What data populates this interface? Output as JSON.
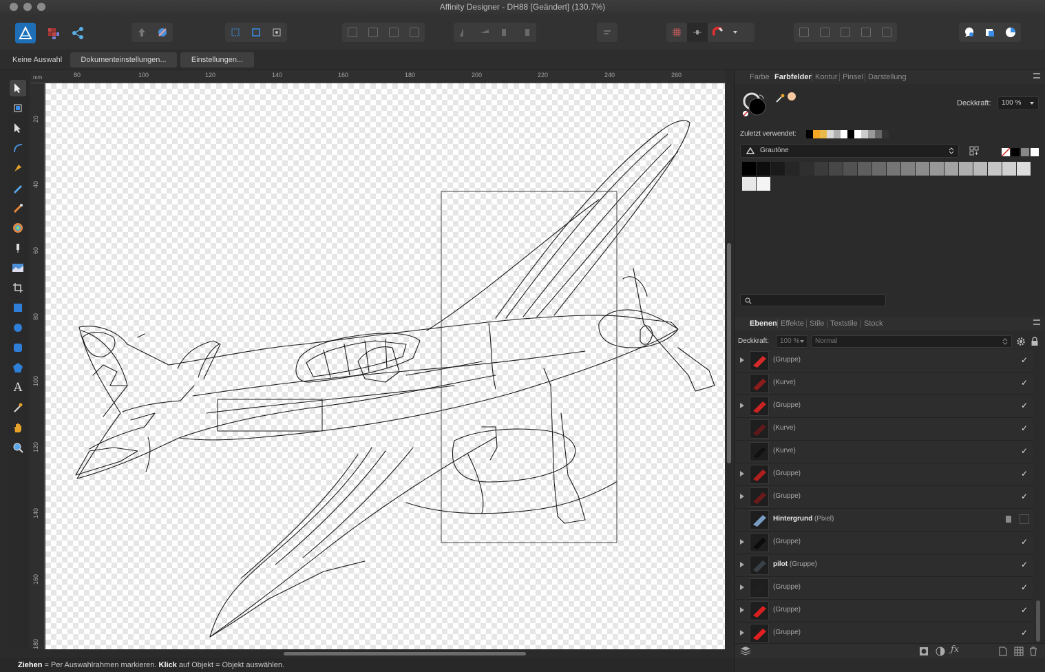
{
  "window": {
    "title": "Affinity Designer - DH88 [Geändert] (130.7%)"
  },
  "personas": [
    "designer-persona-icon",
    "pixel-persona-icon",
    "export-persona-icon"
  ],
  "context": {
    "selection": "Keine Auswahl",
    "doc_settings": "Dokumenteinstellungen...",
    "settings": "Einstellungen..."
  },
  "ruler": {
    "unit": "mm",
    "h_ticks": [
      "80",
      "100",
      "120",
      "140",
      "160",
      "180",
      "200",
      "220",
      "240",
      "260"
    ],
    "v_ticks": [
      "20",
      "40",
      "60",
      "80",
      "100",
      "120",
      "140",
      "160",
      "180"
    ]
  },
  "tools": [
    "move-tool-icon",
    "artboard-tool-icon",
    "node-tool-icon",
    "corner-tool-icon",
    "pen-tool-icon",
    "pencil-tool-icon",
    "brush-tool-icon",
    "fill-tool-icon",
    "transparency-tool-icon",
    "place-image-tool-icon",
    "crop-tool-icon",
    "rectangle-tool-icon",
    "ellipse-tool-icon",
    "rounded-rect-tool-icon",
    "polygon-tool-icon",
    "text-tool-icon",
    "color-picker-tool-icon",
    "hand-tool-icon",
    "zoom-tool-icon"
  ],
  "color_panel": {
    "tabs": [
      "Farbe",
      "Farbfelder",
      "Kontur",
      "Pinsel",
      "Darstellung"
    ],
    "active_tab": "Farbfelder",
    "opacity_label": "Deckkraft:",
    "opacity_value": "100 %",
    "recent_label": "Zuletzt verwendet:",
    "recent_colors": [
      "#000000",
      "#f5a623",
      "#e8b84a",
      "#d9d9d9",
      "#b0b0b0",
      "#ffffff",
      "#000000",
      "#ffffff",
      "#cccccc",
      "#999999",
      "#666666",
      "#333333"
    ],
    "palette_name": "Grautöne",
    "swatches": [
      "#000000",
      "#0d0d0d",
      "#1a1a1a",
      "#262626",
      "#2f2f2f",
      "#3b3b3b",
      "#474747",
      "#525252",
      "#5e5e5e",
      "#6a6a6a",
      "#757575",
      "#818181",
      "#8c8c8c",
      "#989898",
      "#a3a3a3",
      "#afafaf",
      "#bababa",
      "#c6c6c6",
      "#d1d1d1",
      "#dddddd",
      "#e8e8e8",
      "#f4f4f4"
    ]
  },
  "layers_panel": {
    "tabs": [
      "Ebenen",
      "Effekte",
      "Stile",
      "Textstile",
      "Stock"
    ],
    "active_tab": "Ebenen",
    "opacity_label": "Deckkraft:",
    "opacity_value": "100 %",
    "blend_mode": "Normal",
    "layers": [
      {
        "name": "",
        "type": "(Gruppe)",
        "expand": true,
        "thumb": "#d62a2a",
        "visible": true
      },
      {
        "name": "",
        "type": "(Kurve)",
        "expand": false,
        "thumb": "#8a1c1c",
        "visible": true
      },
      {
        "name": "",
        "type": "(Gruppe)",
        "expand": true,
        "thumb": "#cc2222",
        "visible": true
      },
      {
        "name": "",
        "type": "(Kurve)",
        "expand": false,
        "thumb": "#5e1a1a",
        "visible": true
      },
      {
        "name": "",
        "type": "(Kurve)",
        "expand": false,
        "thumb": "#111111",
        "visible": true
      },
      {
        "name": "",
        "type": "(Gruppe)",
        "expand": true,
        "thumb": "#b01e1e",
        "visible": true
      },
      {
        "name": "",
        "type": "(Gruppe)",
        "expand": true,
        "thumb": "#6a1a1a",
        "visible": true
      },
      {
        "name": "Hintergrund",
        "type": "(Pixel)",
        "expand": false,
        "thumb": "#7a9cc4",
        "visible": false,
        "locked": true
      },
      {
        "name": "",
        "type": "(Gruppe)",
        "expand": true,
        "thumb": "#0b0b0b",
        "visible": true
      },
      {
        "name": "pilot",
        "type": "(Gruppe)",
        "expand": true,
        "thumb": "#3a4048",
        "visible": true
      },
      {
        "name": "",
        "type": "(Gruppe)",
        "expand": true,
        "thumb": "#202020",
        "visible": true
      },
      {
        "name": "",
        "type": "(Gruppe)",
        "expand": true,
        "thumb": "#d62020",
        "visible": true
      },
      {
        "name": "",
        "type": "(Gruppe)",
        "expand": true,
        "thumb": "#e02020",
        "visible": true
      }
    ]
  },
  "status": {
    "k1": "Ziehen",
    "t1": " = Per Auswahlrahmen markieren. ",
    "k2": "Klick",
    "t2": " auf Objekt = Objekt auswählen."
  }
}
